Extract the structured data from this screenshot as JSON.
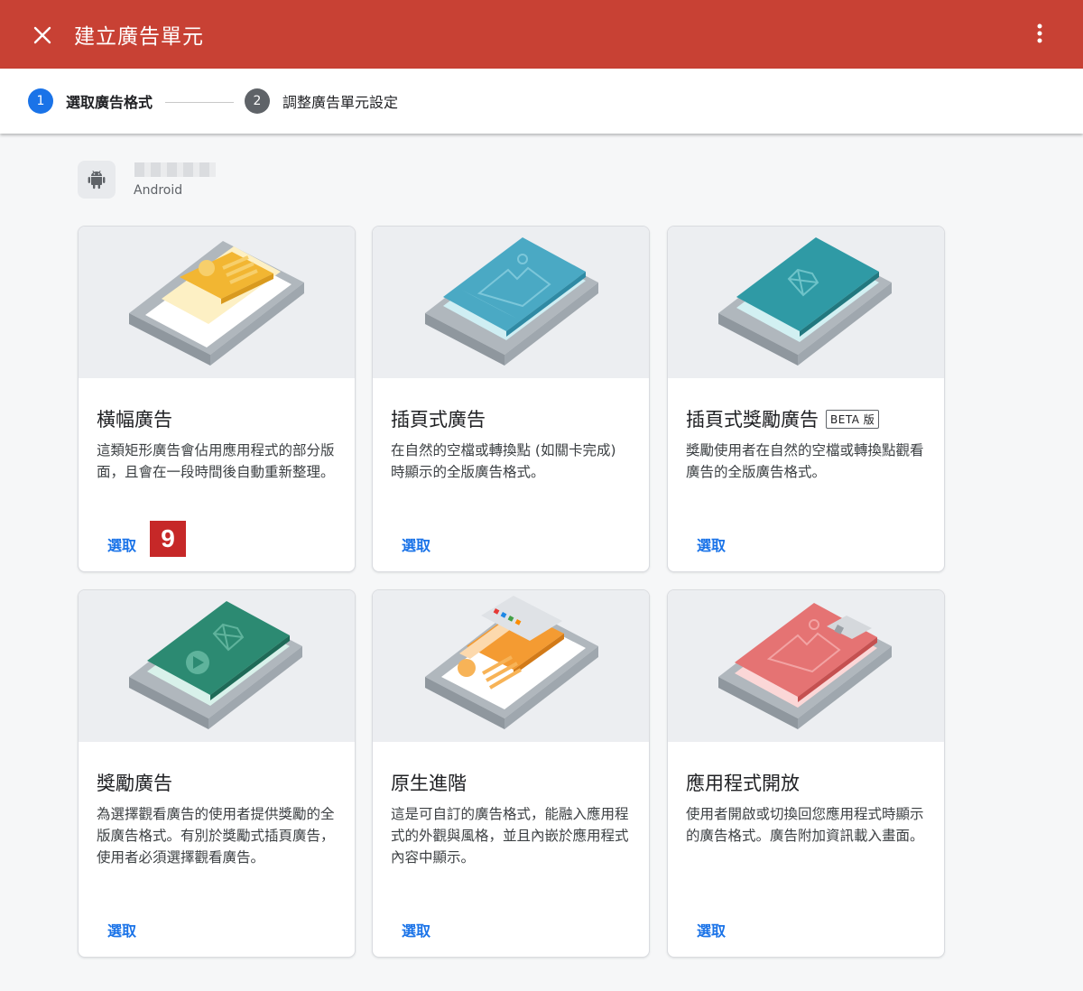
{
  "header": {
    "title": "建立廣告單元",
    "close_icon": "close-icon",
    "more_icon": "more-vert-icon",
    "background_color": "#c84134"
  },
  "stepper": {
    "steps": [
      {
        "number": "1",
        "label": "選取廣告格式",
        "active": true
      },
      {
        "number": "2",
        "label": "調整廣告單元設定",
        "active": false
      }
    ]
  },
  "app": {
    "platform": "Android",
    "icon": "android-icon"
  },
  "cards": [
    {
      "title": "橫幅廣告",
      "description": "這類矩形廣告會佔用應用程式的部分版面，且會在一段時間後自動重新整理。",
      "select_label": "選取"
    },
    {
      "title": "插頁式廣告",
      "description": "在自然的空檔或轉換點 (如關卡完成) 時顯示的全版廣告格式。",
      "select_label": "選取"
    },
    {
      "title": "插頁式獎勵廣告",
      "badge": "BETA 版",
      "description": "獎勵使用者在自然的空檔或轉換點觀看廣告的全版廣告格式。",
      "select_label": "選取"
    },
    {
      "title": "獎勵廣告",
      "description": "為選擇觀看廣告的使用者提供獎勵的全版廣告格式。有別於獎勵式插頁廣告，使用者必須選擇觀看廣告。",
      "select_label": "選取"
    },
    {
      "title": "原生進階",
      "description": "這是可自訂的廣告格式，能融入應用程式的外觀與風格，並且內嵌於應用程式內容中顯示。",
      "select_label": "選取"
    },
    {
      "title": "應用程式開放",
      "description": "使用者開啟或切換回您應用程式時顯示的廣告格式。廣告附加資訊載入畫面。",
      "select_label": "選取"
    }
  ],
  "annotation_badge": "9",
  "colors": {
    "accent": "#1a73e8",
    "banner": "#f2b632",
    "interstitial": "#4aa9c4",
    "rewarded_interstitial": "#2f9aa5",
    "rewarded": "#2c8a72",
    "native": "#f49b32",
    "app_open": "#e57373"
  }
}
